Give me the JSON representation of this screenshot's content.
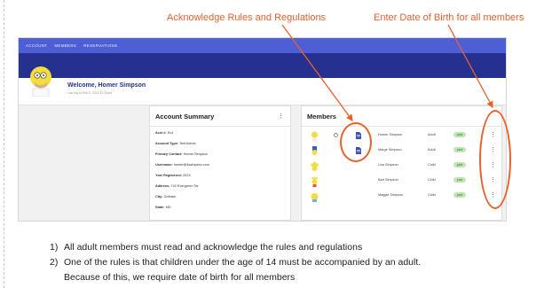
{
  "callouts": {
    "acknowledge": "Acknowledge Rules and Regulations",
    "dob": "Enter Date of Birth for all members"
  },
  "app": {
    "nav_tabs": [
      "ACCOUNT",
      "MEMBERS",
      "RESERVATIONS"
    ],
    "welcome": "Welcome, Homer Simpson",
    "welcome_sub": "Last log in Mar 5, 2023 11:34am",
    "account_summary": {
      "title": "Account Summary",
      "menu": "⋮",
      "rows": [
        {
          "label": "Acct #:",
          "value": "514"
        },
        {
          "label": "Account Type:",
          "value": "Test Admin"
        },
        {
          "label": "Primary Contact:",
          "value": "Homer Simpson"
        },
        {
          "label": "Username:",
          "value": "homer@4sampexx.com"
        },
        {
          "label": "Year Registered:",
          "value": "2023"
        },
        {
          "label": "Address:",
          "value": "742 Evergreen Ter"
        },
        {
          "label": "City:",
          "value": "Gotham"
        },
        {
          "label": "State:",
          "value": "MD"
        }
      ]
    },
    "members": {
      "title": "Members",
      "rows": [
        {
          "name": "Homer Simpson",
          "type": "Adult",
          "badge": "paid",
          "kebab": "⋮"
        },
        {
          "name": "Marge Simpson",
          "type": "Adult",
          "badge": "paid",
          "kebab": "⋮"
        },
        {
          "name": "Lisa Simpson",
          "type": "Child",
          "badge": "paid",
          "kebab": "⋮"
        },
        {
          "name": "Bart Simpson",
          "type": "Child",
          "badge": "paid",
          "kebab": "⋮"
        },
        {
          "name": "Maggie Simpson",
          "type": "Child",
          "badge": "paid",
          "kebab": "⋮"
        }
      ]
    }
  },
  "notes": [
    {
      "num": "1)",
      "text": "All adult members must read and acknowledge the rules and regulations"
    },
    {
      "num": "2)",
      "text": "One of the rules is that children under the age of 14 must be accompanied by an adult."
    },
    {
      "num": "",
      "text": "Because of this, we require date of birth for all members"
    }
  ],
  "colors": {
    "accent": "#e8602c",
    "nav": "#4e5fd6",
    "banner": "#26318f",
    "badge": "#bfe7b3"
  }
}
